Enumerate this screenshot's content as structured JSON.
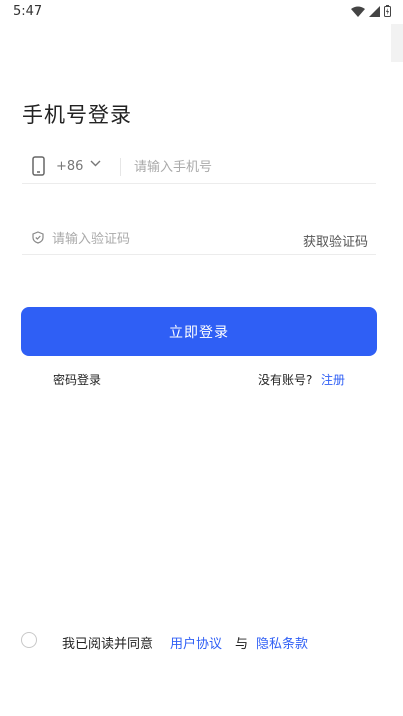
{
  "status_bar": {
    "time": "5:47",
    "icons": [
      "wifi-icon",
      "signal-icon",
      "battery-charging-icon"
    ]
  },
  "title": "手机号登录",
  "phone": {
    "country_code": "+86",
    "placeholder": "请输入手机号",
    "value": ""
  },
  "code": {
    "placeholder": "请输入验证码",
    "value": "",
    "get_code_label": "获取验证码"
  },
  "login_button": "立即登录",
  "password_login": "密码登录",
  "no_account": "没有账号?",
  "register": "注册",
  "agreement": {
    "prefix": "我已阅读并同意",
    "user_agreement": "用户协议",
    "and": "与",
    "privacy": "隐私条款",
    "checked": false
  },
  "colors": {
    "primary": "#2f5ff5",
    "text": "#222222",
    "placeholder": "#aaaaaa"
  }
}
